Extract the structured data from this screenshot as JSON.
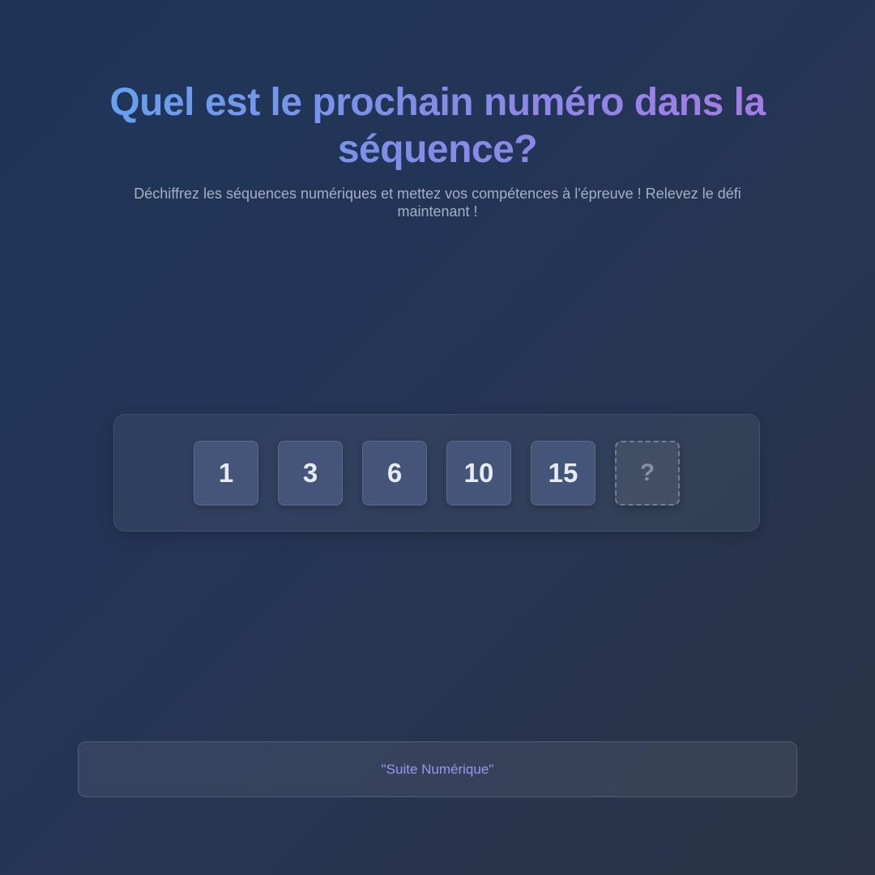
{
  "header": {
    "title": "Quel est le prochain numéro dans la séquence?",
    "subtitle": "Déchiffrez les séquences numériques et mettez vos compétences à l'épreuve ! Relevez le défi maintenant !"
  },
  "sequence": {
    "numbers": [
      "1",
      "3",
      "6",
      "10",
      "15"
    ],
    "unknown": "?"
  },
  "footer": {
    "label": "\"Suite Numérique\""
  },
  "colors": {
    "background_start": "#1e3558",
    "background_end": "#2b3446",
    "title_gradient_start": "#64a2f0",
    "title_gradient_end": "#a97ae6",
    "tile_background": "#45557a",
    "footer_text": "#9a95f0"
  }
}
